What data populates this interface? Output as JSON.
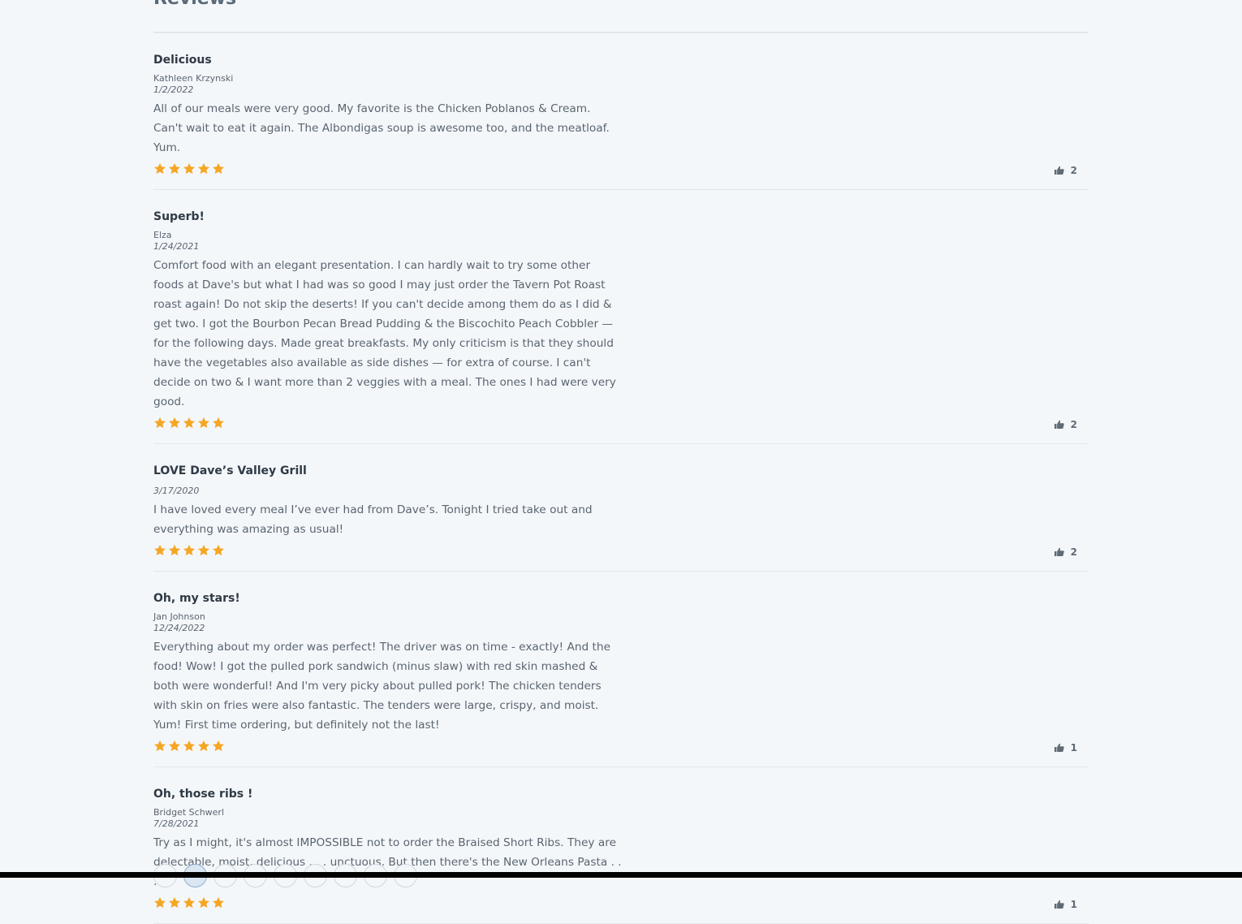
{
  "section": {
    "title": "Reviews"
  },
  "colors": {
    "star": "#f5a623",
    "background": "#f4f7fa",
    "divider": "#e2e7ec"
  },
  "reviews": [
    {
      "title": "Delicious",
      "author": "Kathleen Krzynski",
      "date": "1/2/2022",
      "body": "All of our meals were very good. My favorite is the Chicken Poblanos & Cream. Can't wait to eat it again. The Albondigas soup is awesome too, and the meatloaf. Yum.",
      "rating": 5,
      "likes": "2"
    },
    {
      "title": "Superb!",
      "author": "Elza",
      "date": "1/24/2021",
      "body": "Comfort food with an elegant presentation. I can hardly wait to try some other foods at Dave's but what I had was so good I may just order the Tavern Pot Roast roast again! Do not skip the deserts! If you can't decide among them do as I did & get two. I got the Bourbon Pecan Bread Pudding & the Biscochito Peach Cobbler — for the following days. Made great breakfasts. My only criticism is that they should have the vegetables also available as side dishes — for extra of course. I can't decide on two & I want more than 2 veggies with a meal. The ones I had were very good.",
      "rating": 5,
      "likes": "2"
    },
    {
      "title": "LOVE Dave’s Valley Grill",
      "author": "",
      "date": "3/17/2020",
      "body": "I have loved every meal I’ve ever had from Dave’s. Tonight I tried take out and everything was amazing as usual!",
      "rating": 5,
      "likes": "2"
    },
    {
      "title": "Oh, my stars!",
      "author": "Jan Johnson",
      "date": "12/24/2022",
      "body": "Everything about my order was perfect! The driver was on time - exactly! And the food! Wow! I got the pulled pork sandwich (minus slaw) with red skin mashed & both were wonderful! And I'm very picky about pulled pork! The chicken tenders with skin on fries were also fantastic. The tenders were large, crispy, and moist. Yum! First time ordering, but definitely not the last!",
      "rating": 5,
      "likes": "1"
    },
    {
      "title": "Oh, those ribs !",
      "author": "Bridget Schwerl",
      "date": "7/28/2021",
      "body": "Try as I might, it's almost IMPOSSIBLE not to order the Braised Short Ribs. They are delectable, moist, delicious . . . unctuous. But then there's the New Orleans Pasta . . .",
      "rating": 5,
      "likes": "1"
    }
  ],
  "icons": {
    "star": "star-icon",
    "like": "thumbs-up-icon"
  },
  "pagination": {
    "current_index": 1,
    "count": 9
  }
}
